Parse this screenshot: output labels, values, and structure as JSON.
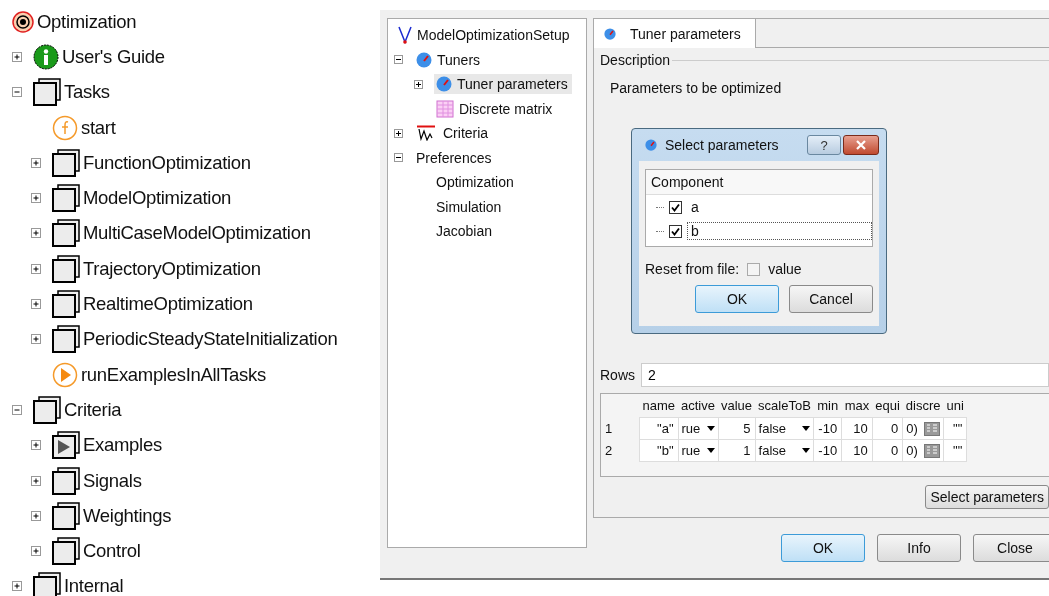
{
  "library_tree": {
    "items": [
      {
        "label": "Optimization",
        "kind": "root",
        "children": [
          {
            "label": "User's Guide",
            "kind": "info",
            "expanded": false
          },
          {
            "label": "Tasks",
            "kind": "package",
            "expanded": true,
            "children": [
              {
                "label": "start",
                "kind": "function"
              },
              {
                "label": "FunctionOptimization",
                "kind": "package",
                "expanded": false
              },
              {
                "label": "ModelOptimization",
                "kind": "package",
                "expanded": false
              },
              {
                "label": "MultiCaseModelOptimization",
                "kind": "package",
                "expanded": false
              },
              {
                "label": "TrajectoryOptimization",
                "kind": "package",
                "expanded": false
              },
              {
                "label": "RealtimeOptimization",
                "kind": "package",
                "expanded": false
              },
              {
                "label": "PeriodicSteadyStateInitialization",
                "kind": "package",
                "expanded": false
              },
              {
                "label": "runExamplesInAllTasks",
                "kind": "run-function"
              }
            ]
          },
          {
            "label": "Criteria",
            "kind": "package",
            "expanded": true,
            "children": [
              {
                "label": "Examples",
                "kind": "examples",
                "expanded": false
              },
              {
                "label": "Signals",
                "kind": "package",
                "expanded": false
              },
              {
                "label": "Weightings",
                "kind": "package",
                "expanded": false
              },
              {
                "label": "Control",
                "kind": "package",
                "expanded": false
              }
            ]
          },
          {
            "label": "Internal",
            "kind": "package",
            "expanded": false
          }
        ]
      }
    ]
  },
  "setup_tree": {
    "items": [
      {
        "label": "ModelOptimizationSetup",
        "kind": "model",
        "selected": false,
        "children": [
          {
            "label": "Tuners",
            "kind": "tuner",
            "expanded": true,
            "selected": false,
            "children": [
              {
                "label": "Tuner parameters",
                "kind": "tuner",
                "expanded": false,
                "selected": true
              },
              {
                "label": "Discrete matrix",
                "kind": "matrix",
                "selected": false
              }
            ]
          },
          {
            "label": "Criteria",
            "kind": "criteria",
            "expanded": false,
            "selected": false
          },
          {
            "label": "Preferences",
            "kind": "plain",
            "expanded": true,
            "selected": false,
            "children": [
              {
                "label": "Optimization",
                "kind": "plain",
                "selected": false
              },
              {
                "label": "Simulation",
                "kind": "plain",
                "selected": false
              },
              {
                "label": "Jacobian",
                "kind": "plain",
                "selected": false
              }
            ]
          }
        ]
      }
    ]
  },
  "tabs": [
    {
      "label": "Tuner parameters",
      "selected": true
    }
  ],
  "description": {
    "title": "Description",
    "text": "Parameters to be optimized"
  },
  "rows_field": {
    "label": "Rows",
    "value": "2"
  },
  "table": {
    "columns": [
      "name",
      "active",
      "value",
      "scaleToB",
      "min",
      "max",
      "equi",
      "discre",
      "uni"
    ],
    "rows": [
      {
        "index": "1",
        "name": "\"a\"",
        "active": "rue",
        "value": "5",
        "scale": "false",
        "min": "-10",
        "max": "10",
        "equi": "0",
        "discre": "0)",
        "unit": "\"\""
      },
      {
        "index": "2",
        "name": "\"b\"",
        "active": "rue",
        "value": "1",
        "scale": "false",
        "min": "-10",
        "max": "10",
        "equi": "0",
        "discre": "0)",
        "unit": "\"\""
      }
    ]
  },
  "select_button": "Select parameters",
  "buttons": [
    {
      "label": "OK",
      "default": true
    },
    {
      "label": "Info",
      "default": false
    },
    {
      "label": "Close",
      "default": false
    }
  ],
  "select_dialog": {
    "title": "Select parameters",
    "help": "?",
    "header": "Component",
    "items": [
      {
        "label": "a",
        "checked": true,
        "editing": false
      },
      {
        "label": "b",
        "checked": true,
        "editing": true
      }
    ],
    "reset_label": "Reset from file:",
    "reset_option": {
      "label": "value",
      "checked": false
    },
    "buttons": [
      {
        "label": "OK",
        "default": true
      },
      {
        "label": "Cancel",
        "default": false
      }
    ]
  }
}
